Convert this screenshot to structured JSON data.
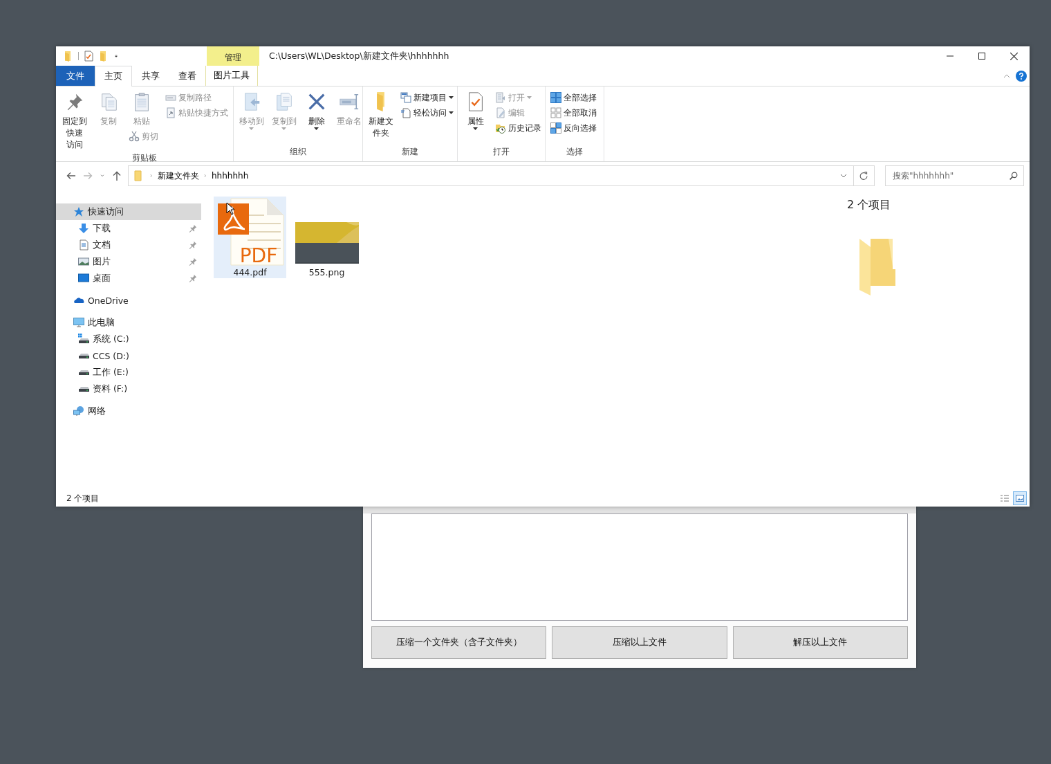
{
  "explorer": {
    "title": "C:\\Users\\WL\\Desktop\\新建文件夹\\hhhhhhh",
    "context_tab": {
      "header": "管理",
      "label": "图片工具",
      "selected": false
    },
    "tabs": [
      {
        "label": "文件",
        "kind": "file",
        "selected": false
      },
      {
        "label": "主页",
        "kind": "normal",
        "selected": true
      },
      {
        "label": "共享",
        "kind": "normal",
        "selected": false
      },
      {
        "label": "查看",
        "kind": "normal",
        "selected": false
      }
    ],
    "ribbon": [
      {
        "title": "剪贴板",
        "columns": [
          [
            {
              "label": "固定到快速访问",
              "kind": "large",
              "disabled": false,
              "dropdown": false
            }
          ],
          [
            {
              "label": "复制",
              "kind": "large",
              "disabled": true,
              "dropdown": false
            }
          ],
          [
            {
              "label": "粘贴",
              "kind": "large",
              "disabled": true,
              "dropdown": false
            },
            {
              "label": "剪切",
              "kind": "small",
              "disabled": true,
              "dropdown": false
            }
          ],
          [
            {
              "label": "复制路径",
              "kind": "small",
              "disabled": true,
              "dropdown": false
            },
            {
              "label": "粘贴快捷方式",
              "kind": "small",
              "disabled": true,
              "dropdown": false
            }
          ]
        ]
      },
      {
        "title": "组织",
        "columns": [
          [
            {
              "label": "移动到",
              "kind": "large",
              "disabled": true,
              "dropdown": true
            }
          ],
          [
            {
              "label": "复制到",
              "kind": "large",
              "disabled": true,
              "dropdown": true
            }
          ],
          [
            {
              "label": "删除",
              "kind": "large",
              "disabled": false,
              "dropdown": true
            }
          ],
          [
            {
              "label": "重命名",
              "kind": "large",
              "disabled": true,
              "dropdown": false
            }
          ]
        ]
      },
      {
        "title": "新建",
        "columns": [
          [
            {
              "label": "新建文件夹",
              "kind": "large",
              "disabled": false,
              "dropdown": false
            }
          ],
          [
            {
              "label": "新建项目",
              "kind": "small",
              "disabled": false,
              "dropdown": true
            },
            {
              "label": "轻松访问",
              "kind": "small",
              "disabled": false,
              "dropdown": true
            }
          ]
        ]
      },
      {
        "title": "打开",
        "columns": [
          [
            {
              "label": "属性",
              "kind": "large",
              "disabled": false,
              "dropdown": true
            }
          ],
          [
            {
              "label": "打开",
              "kind": "small",
              "disabled": true,
              "dropdown": true
            },
            {
              "label": "编辑",
              "kind": "small",
              "disabled": true,
              "dropdown": false
            },
            {
              "label": "历史记录",
              "kind": "small",
              "disabled": false,
              "dropdown": false
            }
          ]
        ]
      },
      {
        "title": "选择",
        "columns": [
          [
            {
              "label": "全部选择",
              "kind": "small",
              "disabled": false,
              "dropdown": false
            },
            {
              "label": "全部取消",
              "kind": "small",
              "disabled": false,
              "dropdown": false
            },
            {
              "label": "反向选择",
              "kind": "small",
              "disabled": false,
              "dropdown": false
            }
          ]
        ]
      }
    ],
    "nav": {
      "buttons": [
        {
          "kind": "back",
          "disabled": false
        },
        {
          "kind": "forward",
          "disabled": true
        },
        {
          "kind": "recent",
          "disabled": false
        },
        {
          "kind": "up",
          "disabled": false
        }
      ],
      "breadcrumbs": [
        "新建文件夹",
        "hhhhhhh"
      ],
      "search_placeholder": "搜索\"hhhhhhh\""
    },
    "sidebar": [
      {
        "label": "快速访问",
        "kind": "quick",
        "selected": true,
        "pinned": false,
        "children": [
          {
            "label": "下载",
            "kind": "download",
            "selected": false,
            "pinned": true
          },
          {
            "label": "文档",
            "kind": "documents",
            "selected": false,
            "pinned": true
          },
          {
            "label": "图片",
            "kind": "pictures",
            "selected": false,
            "pinned": true
          },
          {
            "label": "桌面",
            "kind": "desktop",
            "selected": false,
            "pinned": true
          }
        ]
      },
      {
        "label": "OneDrive",
        "kind": "cloud",
        "selected": false,
        "pinned": false
      },
      {
        "label": "此电脑",
        "kind": "pc",
        "selected": false,
        "pinned": false,
        "children": [
          {
            "label": "系统 (C:)",
            "kind": "system-drive",
            "selected": false,
            "pinned": false
          },
          {
            "label": "CCS (D:)",
            "kind": "drive",
            "selected": false,
            "pinned": false
          },
          {
            "label": "工作 (E:)",
            "kind": "drive",
            "selected": false,
            "pinned": false
          },
          {
            "label": "资料 (F:)",
            "kind": "drive",
            "selected": false,
            "pinned": false
          }
        ]
      },
      {
        "label": "网络",
        "kind": "network",
        "selected": false,
        "pinned": false
      }
    ],
    "files": [
      {
        "name": "444.pdf",
        "kind": "pdf",
        "badge": "PDF",
        "selected": true
      },
      {
        "name": "555.png",
        "selected": false
      }
    ],
    "preview": {
      "text": "2 个项目"
    },
    "status_bar": {
      "text": "2 个项目",
      "views": [
        {
          "kind": "details",
          "selected": false
        },
        {
          "kind": "large_icons",
          "selected": true
        }
      ]
    }
  },
  "app_window": {
    "buttons": [
      "压缩一个文件夹（含子文件夹）",
      "压缩以上文件",
      "解压以上文件"
    ]
  }
}
